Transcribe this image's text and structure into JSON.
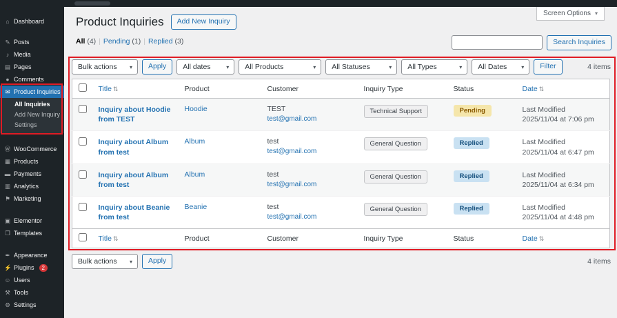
{
  "icons": {
    "chevron_down": "▾",
    "sort": "⇅"
  },
  "colors": {
    "accent": "#2271b1",
    "sidebar_bg": "#1d2327",
    "annotation": "#e01b24",
    "pending_bg": "#f5e6ab",
    "pending_text": "#8a5a00",
    "replied_bg": "#c9e1f2",
    "replied_text": "#17517e"
  },
  "sidebar": {
    "items": [
      {
        "label": "Dashboard",
        "icon": "⌂"
      },
      {
        "label": "Posts",
        "icon": "✎"
      },
      {
        "label": "Media",
        "icon": "♪"
      },
      {
        "label": "Pages",
        "icon": "▤"
      },
      {
        "label": "Comments",
        "icon": "●"
      },
      {
        "label": "Product Inquiries",
        "icon": "✉"
      },
      {
        "label": "WooCommerce",
        "icon": "Ⓦ"
      },
      {
        "label": "Products",
        "icon": "▦"
      },
      {
        "label": "Payments",
        "icon": "▬"
      },
      {
        "label": "Analytics",
        "icon": "▥"
      },
      {
        "label": "Marketing",
        "icon": "⚑"
      },
      {
        "label": "Elementor",
        "icon": "▣"
      },
      {
        "label": "Templates",
        "icon": "❐"
      },
      {
        "label": "Appearance",
        "icon": "✒"
      },
      {
        "label": "Plugins",
        "icon": "⚡",
        "badge": "2"
      },
      {
        "label": "Users",
        "icon": "☺"
      },
      {
        "label": "Tools",
        "icon": "⚒"
      },
      {
        "label": "Settings",
        "icon": "⚙"
      }
    ],
    "submenu": [
      {
        "label": "All Inquiries"
      },
      {
        "label": "Add New Inquiry"
      },
      {
        "label": "Settings"
      }
    ]
  },
  "header": {
    "title": "Product Inquiries",
    "add_new_button": "Add New Inquiry",
    "screen_options": "Screen Options"
  },
  "filters": {
    "separator": "|",
    "views": [
      {
        "label": "All",
        "count": "(4)"
      },
      {
        "label": "Pending",
        "count": "(1)"
      },
      {
        "label": "Replied",
        "count": "(3)"
      }
    ],
    "search_value": "",
    "search_button": "Search Inquiries"
  },
  "toolbar": {
    "bulk_actions": "Bulk actions",
    "apply": "Apply",
    "all_dates": "All dates",
    "all_products": "All Products",
    "all_statuses": "All Statuses",
    "all_types": "All Types",
    "all_dates2": "All Dates",
    "filter_button": "Filter",
    "items_count": "4 items"
  },
  "table": {
    "columns": {
      "title": "Title",
      "product": "Product",
      "customer": "Customer",
      "inquiry_type": "Inquiry Type",
      "status": "Status",
      "date": "Date"
    },
    "rows": [
      {
        "title": "Inquiry about Hoodie from TEST",
        "product": "Hoodie",
        "customer_name": "TEST",
        "customer_email": "test@gmail.com",
        "inquiry_type": "Technical Support",
        "status": "Pending",
        "date_line1": "Last Modified",
        "date_line2": "2025/11/04 at 7:06 pm"
      },
      {
        "title": "Inquiry about Album from test",
        "product": "Album",
        "customer_name": "test",
        "customer_email": "test@gmail.com",
        "inquiry_type": "General Question",
        "status": "Replied",
        "date_line1": "Last Modified",
        "date_line2": "2025/11/04 at 6:47 pm"
      },
      {
        "title": "Inquiry about Album from test",
        "product": "Album",
        "customer_name": "test",
        "customer_email": "test@gmail.com",
        "inquiry_type": "General Question",
        "status": "Replied",
        "date_line1": "Last Modified",
        "date_line2": "2025/11/04 at 6:34 pm"
      },
      {
        "title": "Inquiry about Beanie from test",
        "product": "Beanie",
        "customer_name": "test",
        "customer_email": "test@gmail.com",
        "inquiry_type": "General Question",
        "status": "Replied",
        "date_line1": "Last Modified",
        "date_line2": "2025/11/04 at 4:48 pm"
      }
    ]
  },
  "bottom_toolbar": {
    "bulk_actions": "Bulk actions",
    "apply": "Apply",
    "items_count": "4 items"
  }
}
